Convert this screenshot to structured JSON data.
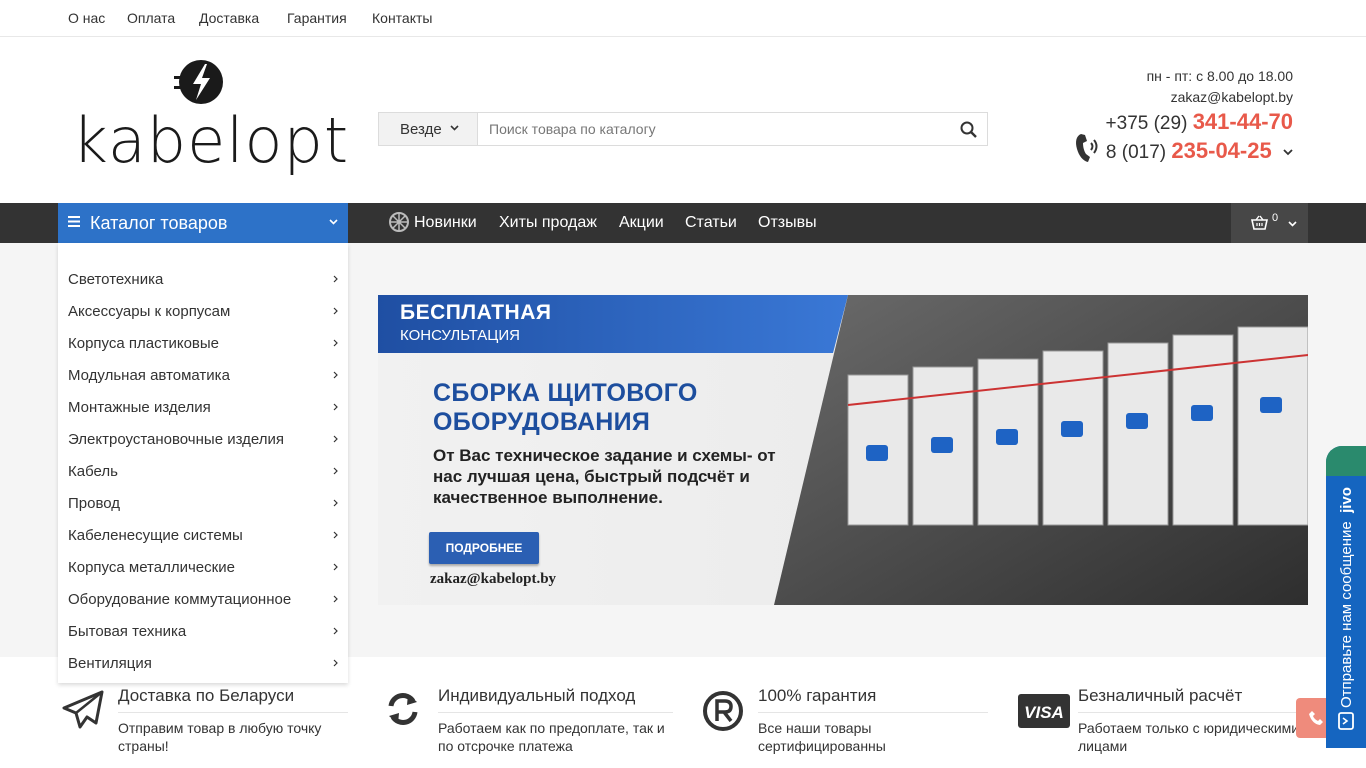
{
  "top_links": [
    "О нас",
    "Оплата",
    "Доставка",
    "Гарантия",
    "Контакты"
  ],
  "logo": {
    "text": "kabelopt"
  },
  "search": {
    "scope": "Везде",
    "placeholder": "Поиск товара по каталогу"
  },
  "contacts": {
    "hours": "пн - пт: с 8.00 до 18.00",
    "email": "zakaz@kabelopt.by",
    "phone1_prefix": "+375 (29)",
    "phone1_number": "341-44-70",
    "phone2_prefix": "8 (017)",
    "phone2_number": "235-04-25"
  },
  "navbar": {
    "catalog_label": "Каталог товаров",
    "links": [
      "Новинки",
      "Хиты продаж",
      "Акции",
      "Статьи",
      "Отзывы"
    ],
    "cart_count": "0"
  },
  "catalog": [
    "Светотехника",
    "Аксессуары к корпусам",
    "Корпуса пластиковые",
    "Модульная автоматика",
    "Монтажные изделия",
    "Электроустановочные изделия",
    "Кабель",
    "Провод",
    "Кабеленесущие системы",
    "Корпуса металлические",
    "Оборудование коммутационное",
    "Бытовая техника",
    "Вентиляция"
  ],
  "banner": {
    "tag_line1": "БЕСПЛАТНАЯ",
    "tag_line2": "КОНСУЛЬТАЦИЯ",
    "title": "СБОРКА ЩИТОВОГО ОБОРУДОВАНИЯ",
    "text": "От Вас техническое задание и схемы- от нас лучшая цена, быстрый подсчёт и качественное выполнение.",
    "button": "ПОДРОБНЕЕ",
    "email": "zakaz@kabelopt.by"
  },
  "features": [
    {
      "title": "Доставка по Беларуси",
      "desc": "Отправим товар в любую точку страны!"
    },
    {
      "title": "Индивидуальный подход",
      "desc": "Работаем как по предоплате, так и по отсрочке платежа"
    },
    {
      "title": "100% гарантия",
      "desc": "Все наши товары сертифицированны"
    },
    {
      "title": "Безналичный расчёт",
      "desc": "Работаем только с юридическими лицами"
    }
  ],
  "jivo": {
    "text": "Отправьте нам сообщение",
    "brand": "jivo"
  },
  "colors": {
    "accent_blue": "#2d72c8",
    "phone_red": "#e8594a",
    "navbar": "#333333"
  }
}
